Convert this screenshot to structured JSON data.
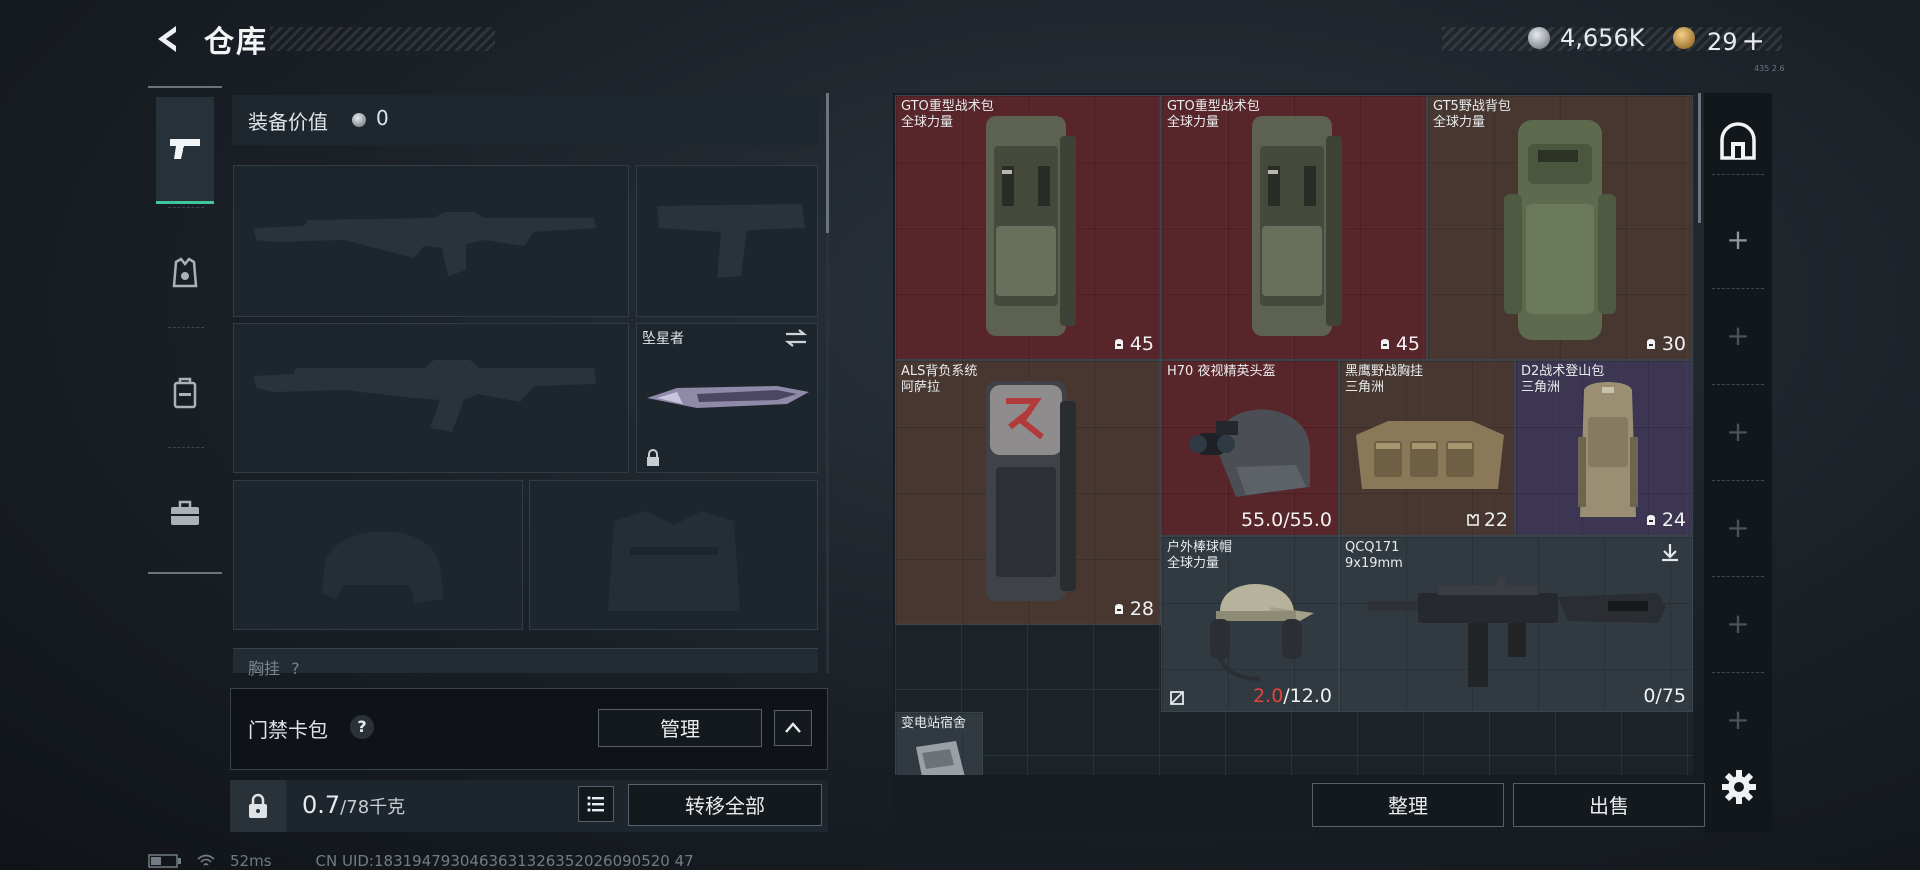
{
  "header": {
    "title": "仓库",
    "silver_value": "4,656K",
    "ticket_value": "29",
    "ticket_plus": "+",
    "tiny_tag": "435 2.6"
  },
  "loadout": {
    "equip_value_label": "装备价值",
    "equip_value": "0",
    "melee_name": "坠星者",
    "chest_label": "胸挂",
    "chest_help": "?",
    "keycard_label": "门禁卡包",
    "keycard_help": "?",
    "manage_label": "管理",
    "weight_current": "0.7",
    "weight_max": "/78千克",
    "transfer_all_label": "转移全部"
  },
  "stash": {
    "items": [
      {
        "name": "GTO重型战术包",
        "sub": "全球力量",
        "count": "45",
        "count_icon": "backpack-capacity-icon",
        "rarity": "red"
      },
      {
        "name": "GTO重型战术包",
        "sub": "全球力量",
        "count": "45",
        "count_icon": "backpack-capacity-icon",
        "rarity": "red"
      },
      {
        "name": "GT5野战背包",
        "sub": "全球力量",
        "count": "30",
        "count_icon": "backpack-capacity-icon",
        "rarity": "brown"
      },
      {
        "name": "ALS背负系统",
        "sub": "阿萨拉",
        "count": "28",
        "count_icon": "backpack-capacity-icon",
        "rarity": "brown"
      },
      {
        "name": "H70 夜视精英头盔",
        "sub": "",
        "durability_current": "55.0",
        "durability_max": "/55.0",
        "rarity": "red"
      },
      {
        "name": "黑鹰野战胸挂",
        "sub": "三角洲",
        "count": "22",
        "count_icon": "vest-capacity-icon",
        "rarity": "brown"
      },
      {
        "name": "D2战术登山包",
        "sub": "三角洲",
        "count": "24",
        "count_icon": "backpack-capacity-icon",
        "rarity": "purple"
      },
      {
        "name": "户外棒球帽",
        "sub": "全球力量",
        "durability_current": "2.0",
        "durability_max": "/12.0",
        "rarity": "gray"
      },
      {
        "name": "QCQ171",
        "sub": "9x19mm",
        "ammo": "0/75",
        "rarity": "gray"
      },
      {
        "name": "变电站宿舍",
        "sub": "",
        "rarity": "gray"
      }
    ],
    "sort_label": "整理",
    "sell_label": "出售"
  },
  "status_bar": {
    "ping": "52ms",
    "uid": "CN UID:1831947930463631326352026090520 47"
  },
  "colors": {
    "accent_green": "#3fc79a",
    "rarity_red": "#69262c",
    "rarity_brown": "#543e34",
    "rarity_purple": "#463c5c",
    "durability_low": "#e0443c"
  }
}
